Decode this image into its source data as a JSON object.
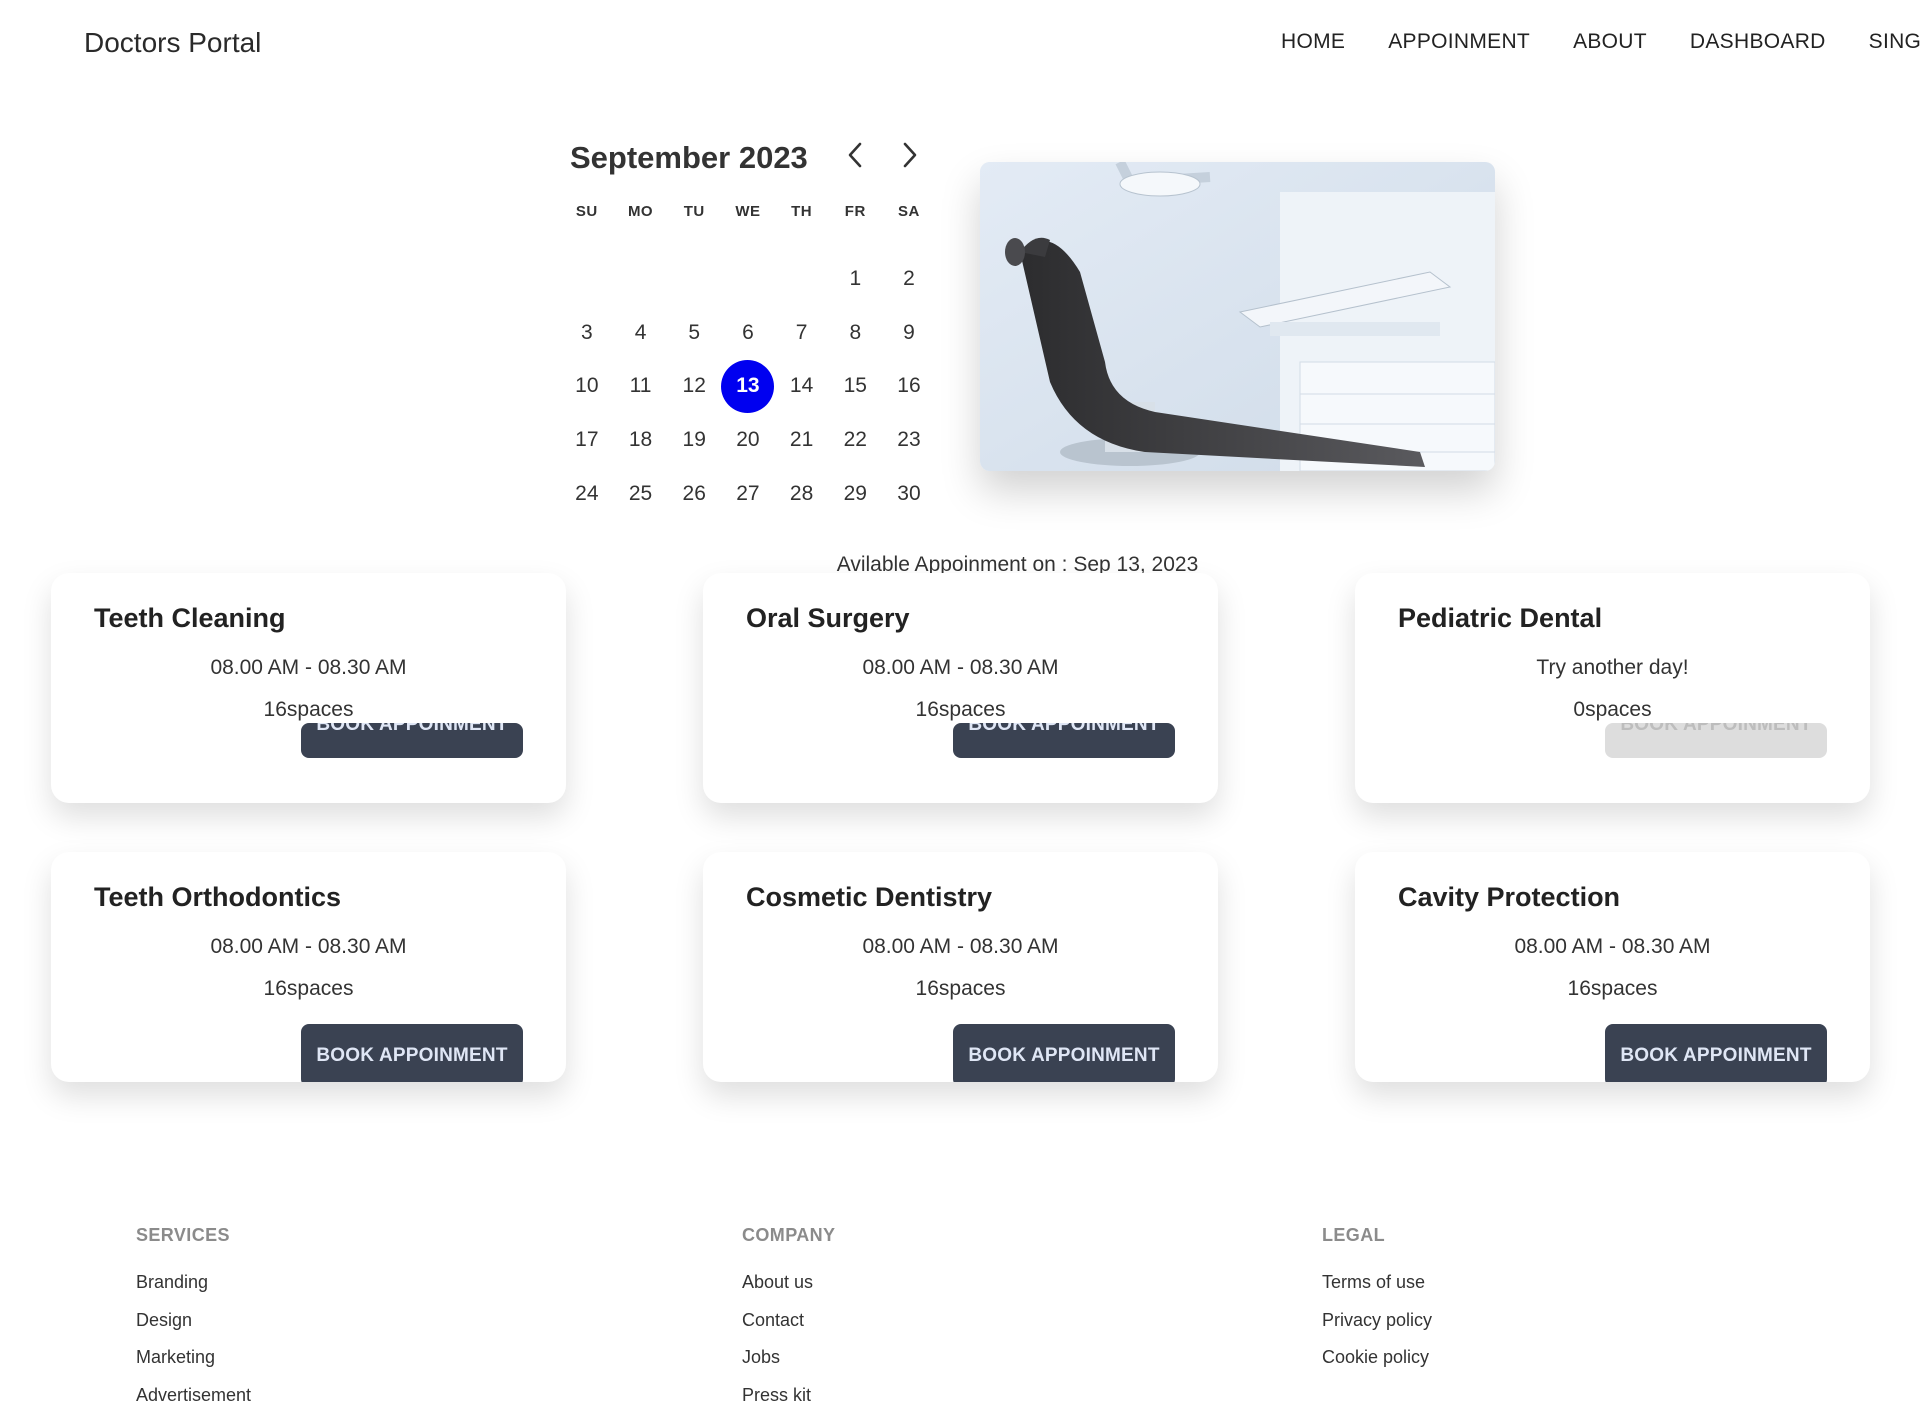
{
  "navbar": {
    "brand": "Doctors Portal",
    "links": [
      "HOME",
      "APPOINMENT",
      "ABOUT",
      "DASHBOARD",
      "SING OUT"
    ]
  },
  "calendar": {
    "month_label": "September 2023",
    "weekdays": [
      "SU",
      "MO",
      "TU",
      "WE",
      "TH",
      "FR",
      "SA"
    ],
    "leading_blanks": 5,
    "days": [
      "1",
      "2",
      "3",
      "4",
      "5",
      "6",
      "7",
      "8",
      "9",
      "10",
      "11",
      "12",
      "13",
      "14",
      "15",
      "16",
      "17",
      "18",
      "19",
      "20",
      "21",
      "22",
      "23",
      "24",
      "25",
      "26",
      "27",
      "28",
      "29",
      "30"
    ],
    "selected_day": "13"
  },
  "availability": {
    "text": "Avilable Appoinment on : Sep 13, 2023"
  },
  "services": [
    {
      "title": "Teeth Cleaning",
      "time": "08.00 AM - 08.30 AM",
      "spaces": "16spaces",
      "button": "BOOK APPOINMENT",
      "disabled": false
    },
    {
      "title": "Oral Surgery",
      "time": "08.00 AM - 08.30 AM",
      "spaces": "16spaces",
      "button": "BOOK APPOINMENT",
      "disabled": false
    },
    {
      "title": "Pediatric Dental",
      "time": "Try another day!",
      "spaces": "0spaces",
      "button": "BOOK APPOINMENT",
      "disabled": true
    },
    {
      "title": "Teeth Orthodontics",
      "time": "08.00 AM - 08.30 AM",
      "spaces": "16spaces",
      "button": "BOOK APPOINMENT",
      "disabled": false
    },
    {
      "title": "Cosmetic Dentistry",
      "time": "08.00 AM - 08.30 AM",
      "spaces": "16spaces",
      "button": "BOOK APPOINMENT",
      "disabled": false
    },
    {
      "title": "Cavity Protection",
      "time": "08.00 AM - 08.30 AM",
      "spaces": "16spaces",
      "button": "BOOK APPOINMENT",
      "disabled": false
    }
  ],
  "footer": {
    "services": {
      "heading": "SERVICES",
      "links": [
        "Branding",
        "Design",
        "Marketing",
        "Advertisement"
      ]
    },
    "company": {
      "heading": "COMPANY",
      "links": [
        "About us",
        "Contact",
        "Jobs",
        "Press kit"
      ]
    },
    "legal": {
      "heading": "LEGAL",
      "links": [
        "Terms of use",
        "Privacy policy",
        "Cookie policy"
      ]
    }
  },
  "colors": {
    "selected_day": "#0000f0",
    "button": "#3a4252",
    "button_text": "#dfe6f5",
    "disabled_button": "#dddddd"
  },
  "icons": {
    "prev_month": "chevron-left-icon",
    "next_month": "chevron-right-icon"
  }
}
